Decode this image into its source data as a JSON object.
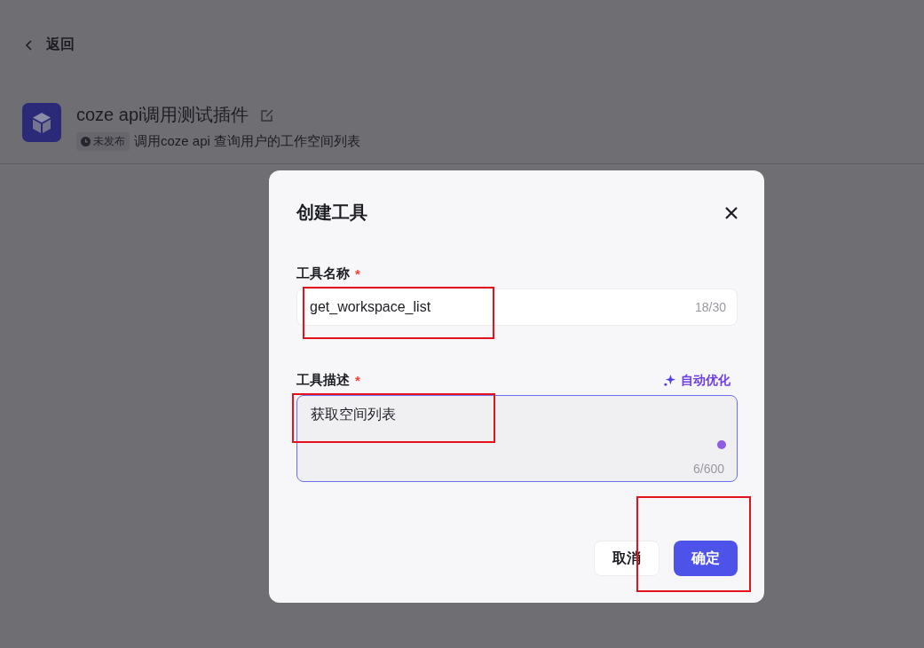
{
  "back": {
    "label": "返回"
  },
  "plugin": {
    "name": "coze api调用测试插件",
    "status": "未发布",
    "description": "调用coze api 查询用户的工作空间列表"
  },
  "dialog": {
    "title": "创建工具",
    "fields": [
      {
        "kind": "input",
        "label": "工具名称",
        "required_mark": "*",
        "value": "get_workspace_list",
        "counter": "18/30",
        "focused": false
      },
      {
        "kind": "textarea",
        "label": "工具描述",
        "required_mark": "*",
        "value": "获取空间列表",
        "counter": "6/600",
        "action": "自动优化",
        "focused": true
      }
    ],
    "buttons": [
      {
        "label": "取消",
        "primary": false
      },
      {
        "label": "确定",
        "primary": true
      }
    ]
  }
}
